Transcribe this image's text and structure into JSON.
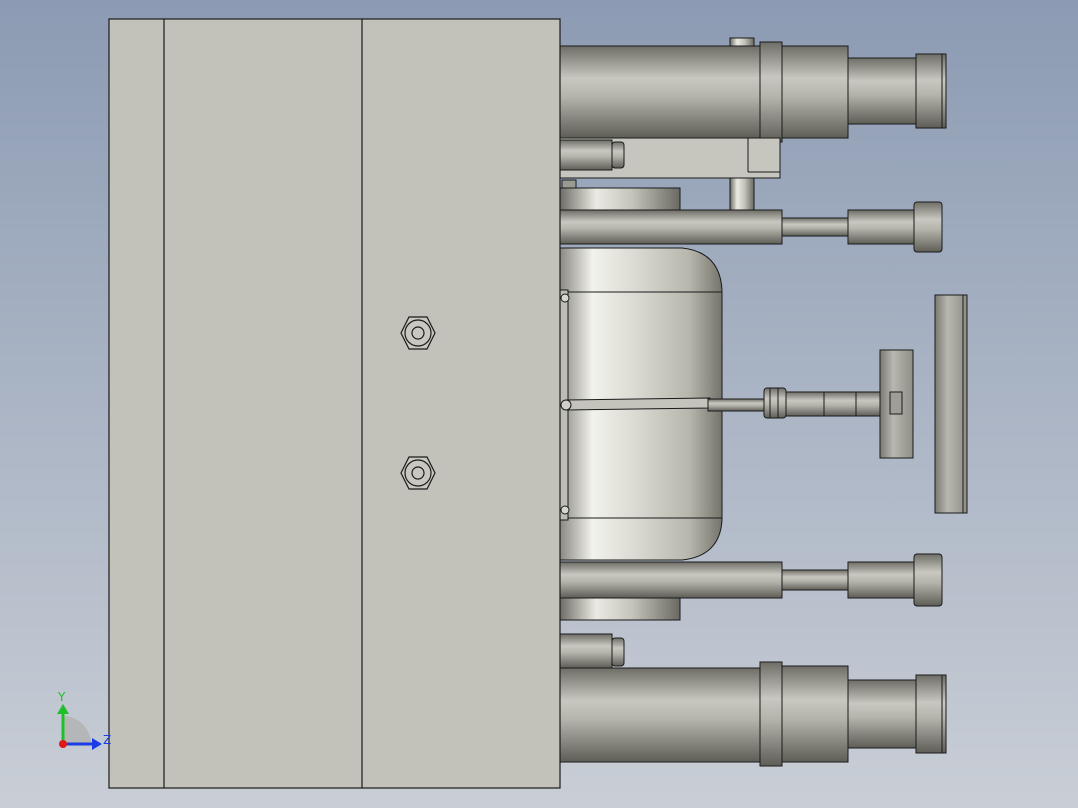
{
  "viewport": {
    "background_top": "#8c9bb3",
    "background_bottom": "#c9ced6"
  },
  "triad": {
    "y_label": "Y",
    "z_label": "Z",
    "y_color": "#1fbf2a",
    "z_color": "#1a3de6",
    "x_color": "#e01818"
  },
  "colors": {
    "plate": "#c2c2ba",
    "edge": "#1a1a1a",
    "metal_dark": "#6e6e66",
    "metal_mid": "#a9a9a0",
    "metal_light": "#e6e6de"
  }
}
